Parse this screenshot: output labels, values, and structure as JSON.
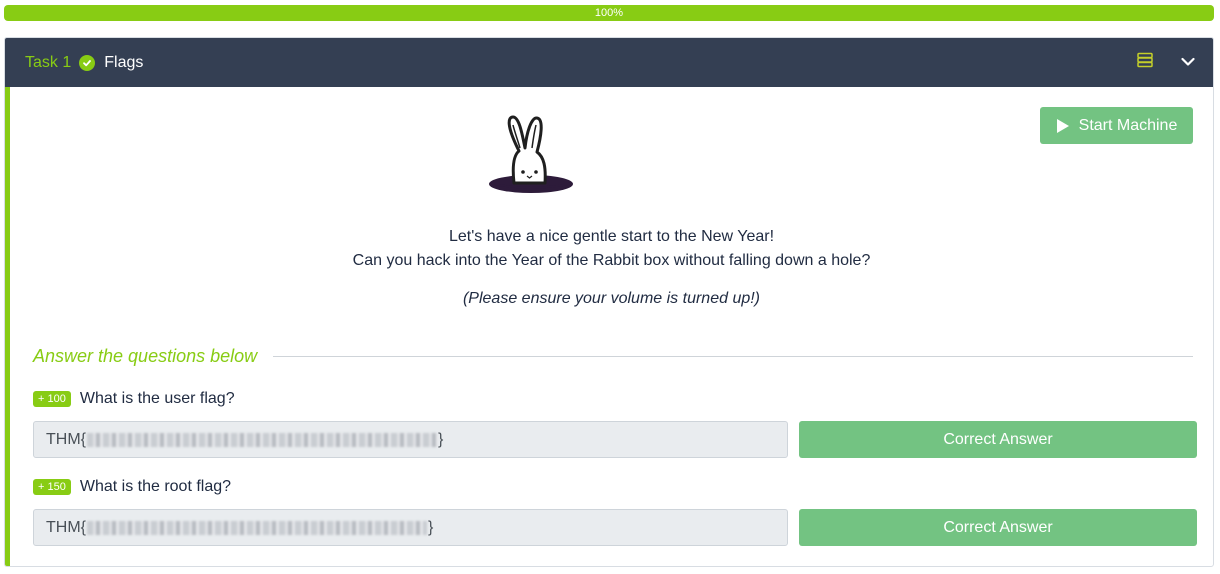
{
  "progress": {
    "label": "100%",
    "value": 100
  },
  "task": {
    "number_label": "Task 1",
    "title": "Flags",
    "status": "completed"
  },
  "header_icons": [
    "server-icon",
    "chevron-down-icon"
  ],
  "start_button": {
    "label": "Start Machine",
    "icon": "play-icon"
  },
  "intro": {
    "line1": "Let's have a nice gentle start to the New Year!",
    "line2": "Can you hack into the Year of the Rabbit box without falling down a hole?",
    "note": "(Please ensure your volume is turned up!)"
  },
  "answers_heading": "Answer the questions below",
  "questions": [
    {
      "points": "+ 100",
      "text": "What is the user flag?",
      "answer_prefix": "THM{",
      "answer_suffix": "}",
      "button": "Correct Answer"
    },
    {
      "points": "+ 150",
      "text": "What is the root flag?",
      "answer_prefix": "THM{",
      "answer_suffix": "}",
      "button": "Correct Answer"
    }
  ],
  "colors": {
    "accent": "#88cc14",
    "header_bg": "#343f53",
    "button_green": "#73c382"
  }
}
